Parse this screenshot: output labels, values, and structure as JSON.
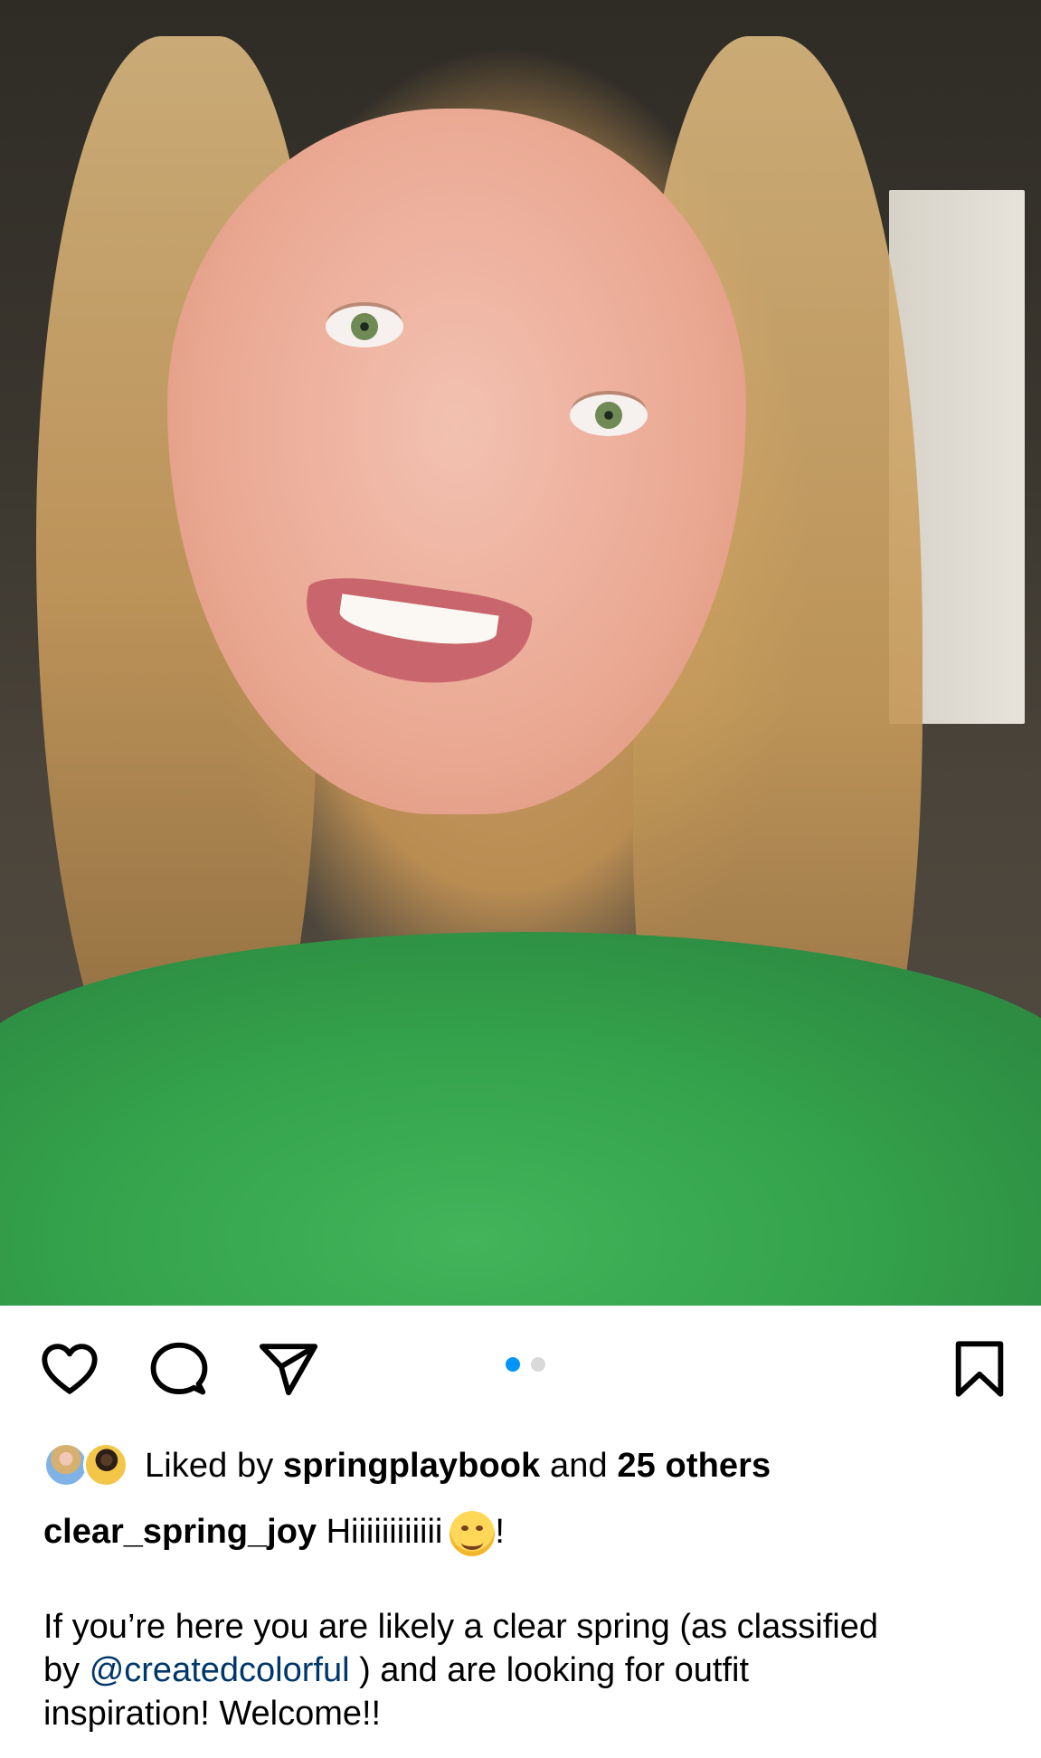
{
  "post": {
    "image_description": "",
    "carousel": {
      "total": 2,
      "active_index": 0
    },
    "liked_by_prefix": "Liked by",
    "liked_by_user": "springplaybook",
    "liked_by_and": "and",
    "liked_by_count": "25 others",
    "caption_user": "clear_spring_joy",
    "caption_first": "Hiiiiiiiiiiii",
    "caption_first_suffix": "!",
    "body_part1": "If you’re here you are likely a clear spring (as classified",
    "body_by": "by",
    "body_mention": "@createdcolorful",
    "body_part2": ") and are looking for outfit",
    "body_part3": "inspiration! Welcome!!"
  },
  "icons": {
    "like": "heart-icon",
    "comment": "comment-icon",
    "share": "share-icon",
    "save": "bookmark-icon",
    "emoji": "smiling-face-emoji"
  },
  "colors": {
    "accent": "#0095f6",
    "dot_inactive": "#d9d9d9",
    "mention": "#00376b"
  }
}
